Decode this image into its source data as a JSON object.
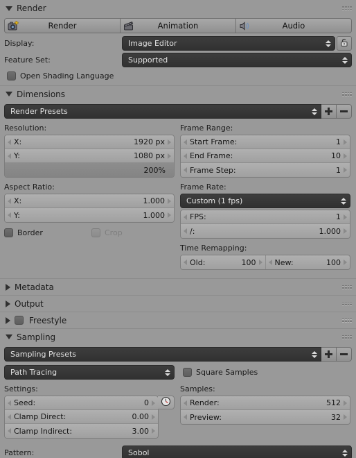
{
  "panels": {
    "render": {
      "title": "Render",
      "collapsed": false,
      "operators": [
        {
          "label": "Render",
          "icon": "camera-render-icon"
        },
        {
          "label": "Animation",
          "icon": "clapperboard-icon"
        },
        {
          "label": "Audio",
          "icon": "speaker-icon"
        }
      ],
      "display": {
        "label": "Display:",
        "value": "Image Editor",
        "lock_icon": "padlock-open-icon"
      },
      "feature_set": {
        "label": "Feature Set:",
        "value": "Supported"
      },
      "osl": {
        "label": "Open Shading Language",
        "checked": false
      }
    },
    "dimensions": {
      "title": "Dimensions",
      "collapsed": false,
      "preset": {
        "value": "Render Presets",
        "add_icon": "plus-icon",
        "remove_icon": "minus-icon"
      },
      "resolution": {
        "heading": "Resolution:",
        "x": {
          "label": "X:",
          "value": "1920 px"
        },
        "y": {
          "label": "Y:",
          "value": "1080 px"
        },
        "percentage": "200%"
      },
      "aspect_ratio": {
        "heading": "Aspect Ratio:",
        "x": {
          "label": "X:",
          "value": "1.000"
        },
        "y": {
          "label": "Y:",
          "value": "1.000"
        }
      },
      "border": {
        "label": "Border",
        "checked": false
      },
      "crop": {
        "label": "Crop",
        "checked": false,
        "disabled": true
      },
      "frame_range": {
        "heading": "Frame Range:",
        "start": {
          "label": "Start Frame:",
          "value": "1"
        },
        "end": {
          "label": "End Frame:",
          "value": "10"
        },
        "step": {
          "label": "Frame Step:",
          "value": "1"
        }
      },
      "frame_rate": {
        "heading": "Frame Rate:",
        "preset": "Custom (1 fps)",
        "fps": {
          "label": "FPS:",
          "value": "1"
        },
        "base": {
          "label": "/:",
          "value": "1.000"
        }
      },
      "time_remapping": {
        "heading": "Time Remapping:",
        "old": {
          "label": "Old:",
          "value": "100"
        },
        "new": {
          "label": "New:",
          "value": "100"
        }
      }
    },
    "metadata": {
      "title": "Metadata",
      "collapsed": true
    },
    "output": {
      "title": "Output",
      "collapsed": true
    },
    "freestyle": {
      "title": "Freestyle",
      "collapsed": true,
      "checked": false
    },
    "sampling": {
      "title": "Sampling",
      "collapsed": false,
      "preset": {
        "value": "Sampling Presets",
        "add_icon": "plus-icon",
        "remove_icon": "minus-icon"
      },
      "integrator": "Path Tracing",
      "square_samples": {
        "label": "Square Samples",
        "checked": false
      },
      "settings": {
        "heading": "Settings:",
        "seed": {
          "label": "Seed:",
          "value": "0",
          "animate_icon": "clock-icon"
        },
        "clamp_direct": {
          "label": "Clamp Direct:",
          "value": "0.00"
        },
        "clamp_indirect": {
          "label": "Clamp Indirect:",
          "value": "3.00"
        }
      },
      "samples": {
        "heading": "Samples:",
        "render": {
          "label": "Render:",
          "value": "512"
        },
        "preview": {
          "label": "Preview:",
          "value": "32"
        }
      },
      "pattern": {
        "label": "Pattern:",
        "value": "Sobol"
      }
    }
  },
  "colors": {
    "background": "#999999",
    "panel_dark_field": "#343434",
    "field_light": "#a8a8a8",
    "text": "#1a1a1a",
    "text_light": "#e2e2e2"
  }
}
